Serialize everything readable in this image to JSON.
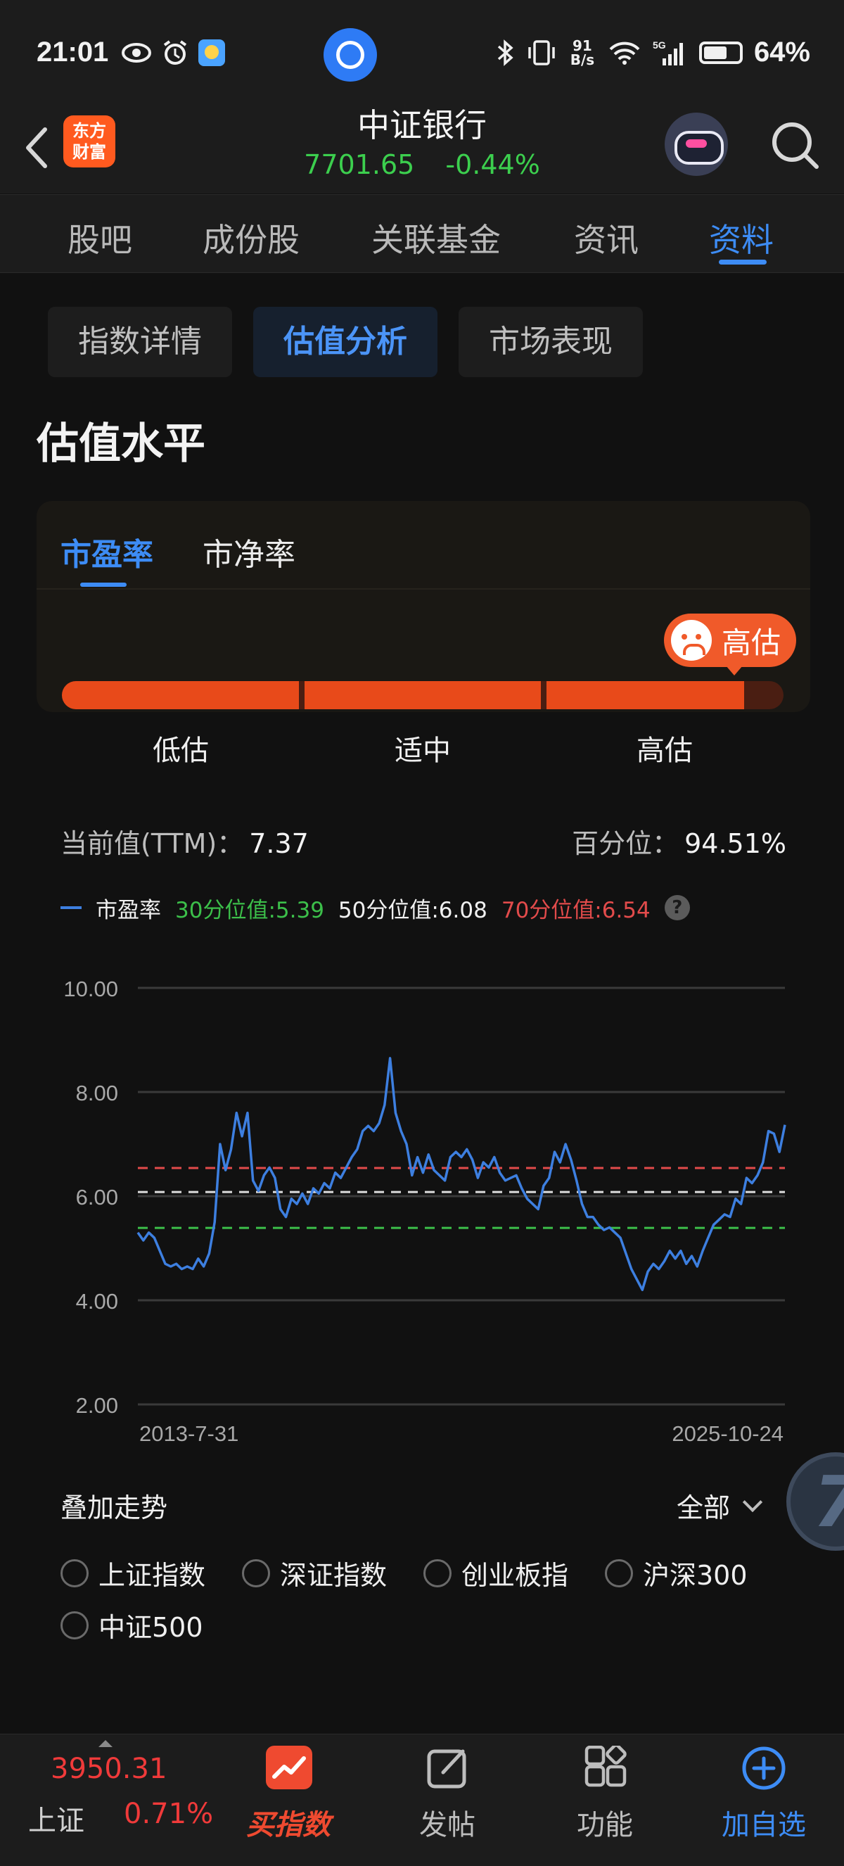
{
  "status_bar": {
    "time": "21:01",
    "net_speed": "91 B/s",
    "battery": "64%",
    "icons": [
      "eye-icon",
      "alarm-icon",
      "weather-icon",
      "bluetooth-icon",
      "vibrate-icon",
      "wifi-icon",
      "5g-signal-icon",
      "battery-icon"
    ]
  },
  "header": {
    "logo_text": "东方财富",
    "title": "中证银行",
    "price": "7701.65",
    "change": "-0.44%",
    "quote_color": "#3ccf4e"
  },
  "main_tabs": [
    {
      "label": "股吧",
      "active": false
    },
    {
      "label": "成份股",
      "active": false
    },
    {
      "label": "关联基金",
      "active": false
    },
    {
      "label": "资讯",
      "active": false
    },
    {
      "label": "资料",
      "active": true
    }
  ],
  "sub_tabs": [
    {
      "label": "指数详情",
      "active": false
    },
    {
      "label": "估值分析",
      "active": true
    },
    {
      "label": "市场表现",
      "active": false
    }
  ],
  "section_title": "估值水平",
  "valuation": {
    "tabs": [
      {
        "label": "市盈率",
        "active": true
      },
      {
        "label": "市净率",
        "active": false
      }
    ],
    "badge": "高估",
    "level_position_fraction": 0.945,
    "levels": [
      "低估",
      "适中",
      "高估"
    ],
    "current_label": "当前值(TTM)：",
    "current_value": "7.37",
    "percentile_label": "百分位：",
    "percentile_value": "94.51%"
  },
  "legend": {
    "series_name": "市盈率",
    "p30": "30分位值:5.39",
    "p50": "50分位值:6.08",
    "p70": "70分位值:6.54"
  },
  "chart_data": {
    "type": "line",
    "ylim": [
      2,
      10
    ],
    "yticks": [
      "10.00",
      "8.00",
      "6.00",
      "4.00",
      "2.00"
    ],
    "x_start_label": "2013-7-31",
    "x_end_label": "2025-10-24",
    "reference_lines": [
      {
        "name": "70分位值",
        "value": 6.54,
        "color": "#e24b4b"
      },
      {
        "name": "50分位值",
        "value": 6.08,
        "color": "#dddddd"
      },
      {
        "name": "30分位值",
        "value": 5.39,
        "color": "#3cbf4a"
      }
    ],
    "series": [
      {
        "name": "市盈率",
        "color": "#3d7fe0",
        "values": [
          5.3,
          5.15,
          5.3,
          5.2,
          4.95,
          4.7,
          4.65,
          4.7,
          4.6,
          4.65,
          4.6,
          4.8,
          4.65,
          4.9,
          5.5,
          7.0,
          6.5,
          6.9,
          7.6,
          7.15,
          7.6,
          6.3,
          6.1,
          6.4,
          6.55,
          6.35,
          5.75,
          5.6,
          5.95,
          5.85,
          6.05,
          5.85,
          6.15,
          6.05,
          6.25,
          6.15,
          6.45,
          6.35,
          6.55,
          6.75,
          6.9,
          7.25,
          7.35,
          7.25,
          7.4,
          7.75,
          8.65,
          7.6,
          7.25,
          7.0,
          6.4,
          6.75,
          6.45,
          6.8,
          6.5,
          6.4,
          6.3,
          6.75,
          6.85,
          6.75,
          6.9,
          6.7,
          6.35,
          6.65,
          6.55,
          6.75,
          6.45,
          6.3,
          6.35,
          6.4,
          6.15,
          5.95,
          5.85,
          5.75,
          6.2,
          6.35,
          6.85,
          6.65,
          7.0,
          6.7,
          6.3,
          5.85,
          5.6,
          5.6,
          5.45,
          5.35,
          5.4,
          5.3,
          5.2,
          4.9,
          4.6,
          4.4,
          4.2,
          4.55,
          4.7,
          4.6,
          4.75,
          4.95,
          4.8,
          4.95,
          4.7,
          4.85,
          4.65,
          4.95,
          5.2,
          5.45,
          5.55,
          5.65,
          5.6,
          5.95,
          5.85,
          6.35,
          6.25,
          6.4,
          6.65,
          7.25,
          7.2,
          6.85,
          7.37
        ]
      }
    ],
    "grid": true
  },
  "overlay": {
    "title": "叠加走势",
    "range": "全部",
    "options": [
      "上证指数",
      "深证指数",
      "创业板指",
      "沪深300",
      "中证500"
    ]
  },
  "bottom_bar": {
    "index_value": "3950.31",
    "index_name": "上证",
    "index_change": "0.71%",
    "buy_label": "买指数",
    "post_label": "发帖",
    "func_label": "功能",
    "add_label": "加自选"
  }
}
